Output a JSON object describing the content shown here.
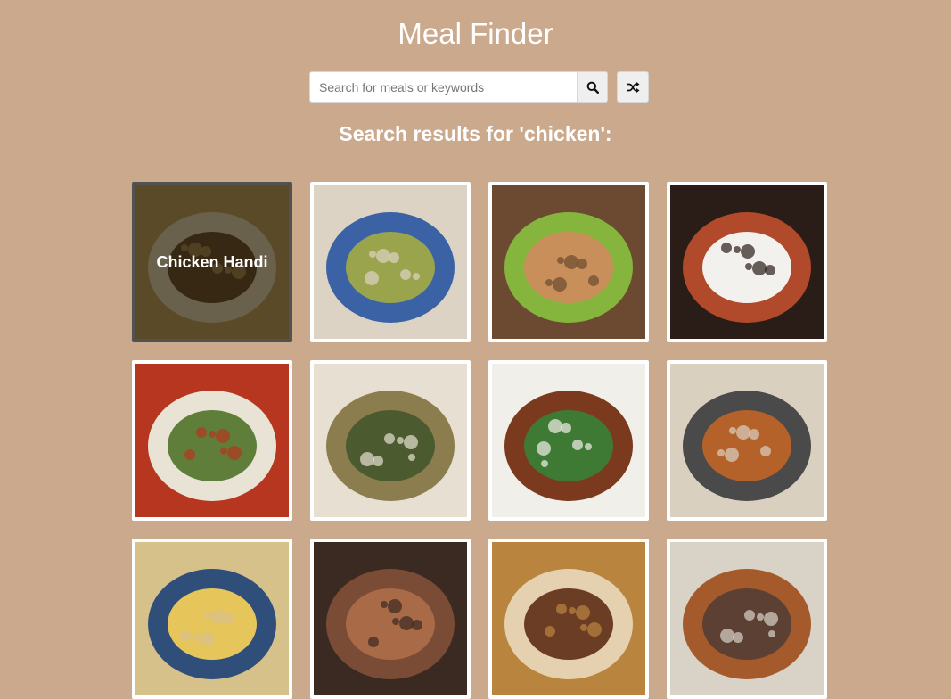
{
  "header": {
    "title": "Meal Finder"
  },
  "search": {
    "placeholder": "Search for meals or keywords",
    "value": "",
    "search_icon": "search-icon",
    "random_icon": "shuffle-icon"
  },
  "results": {
    "heading": "Search results for 'chicken':"
  },
  "meals": [
    {
      "name": "Chicken Handi",
      "visible_title": true,
      "palette": [
        "#c8a45a",
        "#e9d8a6",
        "#7a5a2c"
      ]
    },
    {
      "name": "",
      "visible_title": false,
      "palette": [
        "#dcd3c4",
        "#3b62a5",
        "#9aa44c"
      ]
    },
    {
      "name": "",
      "visible_title": false,
      "palette": [
        "#6b4a31",
        "#86b53e",
        "#c98f5a"
      ]
    },
    {
      "name": "",
      "visible_title": false,
      "palette": [
        "#2a1d18",
        "#b04a2b",
        "#f3f1ee"
      ]
    },
    {
      "name": "",
      "visible_title": false,
      "palette": [
        "#b7361f",
        "#e9e3d6",
        "#5f7e3a"
      ]
    },
    {
      "name": "",
      "visible_title": false,
      "palette": [
        "#e7e0d2",
        "#8c7d4f",
        "#4b5a2f"
      ]
    },
    {
      "name": "",
      "visible_title": false,
      "palette": [
        "#f1efe9",
        "#7b3a1e",
        "#3f7a35"
      ]
    },
    {
      "name": "",
      "visible_title": false,
      "palette": [
        "#d9d0c0",
        "#4a4a4a",
        "#b5622a"
      ]
    },
    {
      "name": "",
      "visible_title": false,
      "palette": [
        "#d7c18a",
        "#2f4e7a",
        "#e6c55b"
      ]
    },
    {
      "name": "",
      "visible_title": false,
      "palette": [
        "#3a2a22",
        "#7a4b35",
        "#a86a47"
      ]
    },
    {
      "name": "",
      "visible_title": false,
      "palette": [
        "#b8843e",
        "#e5d1b0",
        "#6b3d25"
      ]
    },
    {
      "name": "",
      "visible_title": false,
      "palette": [
        "#d8d2c7",
        "#a45a2a",
        "#5c4033"
      ]
    }
  ],
  "colors": {
    "background": "#cba98c",
    "card_border": "#ffffff",
    "hover_border": "#525252"
  }
}
